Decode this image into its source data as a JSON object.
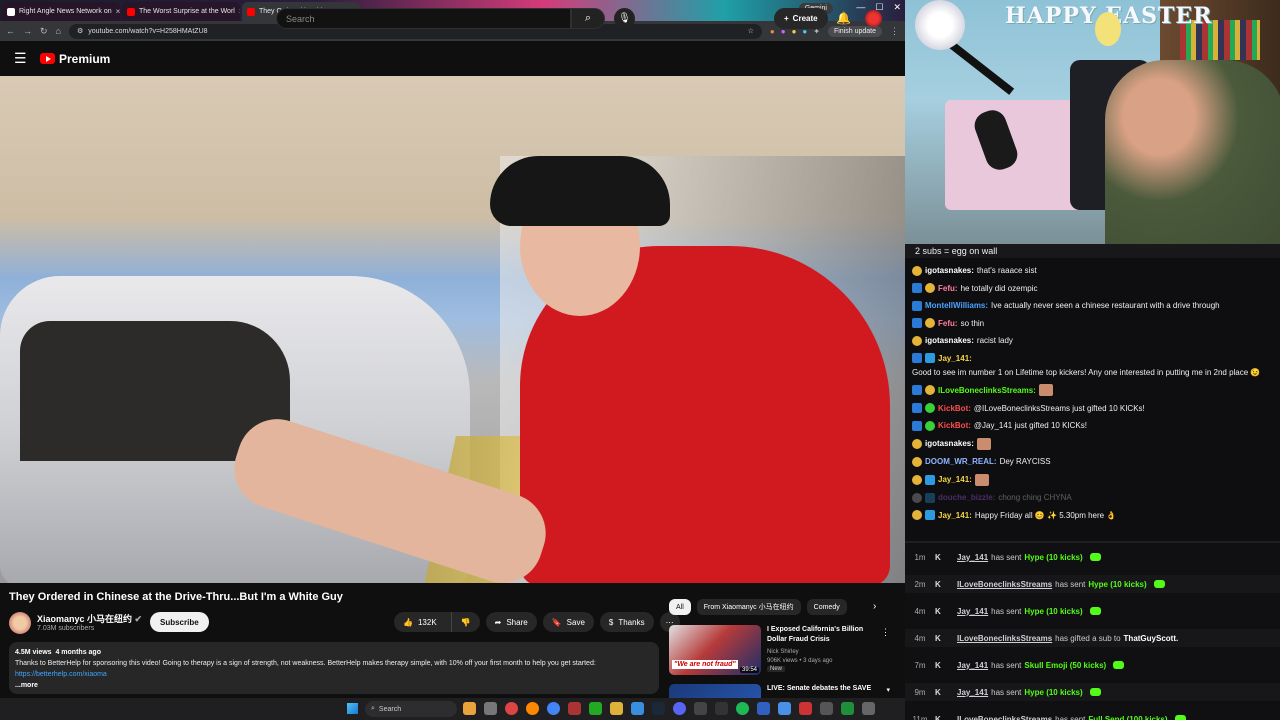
{
  "browser": {
    "tabs": [
      {
        "label": "Right Angle News Network on"
      },
      {
        "label": "The Worst Surprise at the Worl"
      },
      {
        "label": "They Ordered in Chinese at"
      }
    ],
    "gemini": "Gemini",
    "url": "youtube.com/watch?v=H258HMAtZU8",
    "finish_update": "Finish update"
  },
  "youtube": {
    "logo": "Premium",
    "search_placeholder": "Search",
    "create": "Create",
    "video_title": "They Ordered in Chinese at the Drive-Thru...But I'm a White Guy",
    "channel_name": "Xiaomanyc 小马在纽约",
    "subscribers": "7.03M subscribers",
    "subscribe": "Subscribe",
    "likes": "132K",
    "share": "Share",
    "save": "Save",
    "thanks": "Thanks",
    "views": "4.5M views",
    "age": "4 months ago",
    "description": "Thanks to BetterHelp for sponsoring this video! Going to therapy is a sign of strength, not weakness. BetterHelp makes therapy simple, with 10% off your first month to help you get started:",
    "description_link": "https://betterhelp.com/xiaoma",
    "more": "...more",
    "chips": [
      "All",
      "From Xiaomanyc 小马在纽约",
      "Comedy"
    ],
    "recommendations": [
      {
        "title": "I Exposed California's Billion Dollar Fraud Crisis",
        "channel": "Nick Shirley",
        "meta": "906K views • 3 days ago",
        "badge": "New",
        "duration": "39:54",
        "thumb_text": "\"We are not fraud\""
      },
      {
        "title": "LIVE: Senate debates the SAVE",
        "channel": "",
        "meta": "",
        "badge": "",
        "duration": "",
        "thumb_text": ""
      }
    ]
  },
  "taskbar": {
    "search": "Search"
  },
  "stream": {
    "webcam_banner": "HAPPY EASTER",
    "subs_goal": "2 subs = egg on wall",
    "chat": [
      {
        "user": "igotasnakes",
        "color": "#ffffff",
        "text": "that's raaace sist",
        "badges": [
          "b-gold"
        ]
      },
      {
        "user": "Fefu",
        "color": "#ff7fa0",
        "text": "he totally did ozempic",
        "badges": [
          "b-blue",
          "b-gold"
        ]
      },
      {
        "user": "MontellWilliams",
        "color": "#4aa3ff",
        "text": "Ive actually never seen a chinese restaurant with a drive through",
        "badges": [
          "b-blue"
        ]
      },
      {
        "user": "Fefu",
        "color": "#ff7fa0",
        "text": "so thin",
        "badges": [
          "b-blue",
          "b-gold"
        ]
      },
      {
        "user": "igotasnakes",
        "color": "#ffffff",
        "text": "racist lady",
        "badges": [
          "b-gold"
        ]
      },
      {
        "user": "Jay_141",
        "color": "#f5d442",
        "text": "Good to see im number 1 on Lifetime top kickers! Any one interested in putting me in 2nd place 😉",
        "badges": [
          "b-blue",
          "b-cube"
        ]
      },
      {
        "user": "ILoveBoneclinksStreams",
        "color": "#53fc18",
        "text": "",
        "badges": [
          "b-blue",
          "b-gold"
        ]
      },
      {
        "user": "KickBot",
        "color": "#ff4d4d",
        "text": "@ILoveBoneclinksStreams just gifted 10 KICKs!",
        "badges": [
          "b-blue",
          "b-green"
        ]
      },
      {
        "user": "KickBot",
        "color": "#ff4d4d",
        "text": "@Jay_141 just gifted 10 KICKs!",
        "badges": [
          "b-blue",
          "b-green"
        ]
      },
      {
        "user": "igotasnakes",
        "color": "#ffffff",
        "text": "",
        "badges": [
          "b-gold"
        ]
      },
      {
        "user": "DOOM_WR_REAL",
        "color": "#8fb4ff",
        "text": "Dey RAYCISS",
        "badges": [
          "b-gold"
        ]
      },
      {
        "user": "Jay_141",
        "color": "#f5d442",
        "text": "",
        "badges": [
          "b-gold",
          "b-cube"
        ]
      },
      {
        "user": "douche_bizzle",
        "color": "#b46bff",
        "text": "chong ching CHYNA",
        "badges": [
          "b-skull",
          "b-cube"
        ]
      },
      {
        "user": "Jay_141",
        "color": "#f5d442",
        "text": "Happy Friday all 😊 ✨ 5.30pm here 👌",
        "badges": [
          "b-gold",
          "b-cube"
        ]
      }
    ],
    "events": [
      {
        "time": "1m",
        "user": "Jay_141",
        "action": "has sent",
        "gift": "Hype (10 kicks)",
        "kick": true
      },
      {
        "time": "2m",
        "user": "ILoveBoneclinksStreams",
        "action": "has sent",
        "gift": "Hype (10 kicks)",
        "kick": true
      },
      {
        "time": "4m",
        "user": "Jay_141",
        "action": "has sent",
        "gift": "Hype (10 kicks)",
        "kick": true
      },
      {
        "time": "4m",
        "user": "ILoveBoneclinksStreams",
        "action": "has gifted a sub to",
        "gift": "ThatGuyScott.",
        "kick": false
      },
      {
        "time": "7m",
        "user": "Jay_141",
        "action": "has sent",
        "gift": "Skull Emoji (50 kicks)",
        "kick": true
      },
      {
        "time": "9m",
        "user": "Jay_141",
        "action": "has sent",
        "gift": "Hype (10 kicks)",
        "kick": true
      },
      {
        "time": "11m",
        "user": "ILoveBoneclinksStreams",
        "action": "has sent",
        "gift": "Full Send (100 kicks)",
        "kick": true
      }
    ]
  }
}
